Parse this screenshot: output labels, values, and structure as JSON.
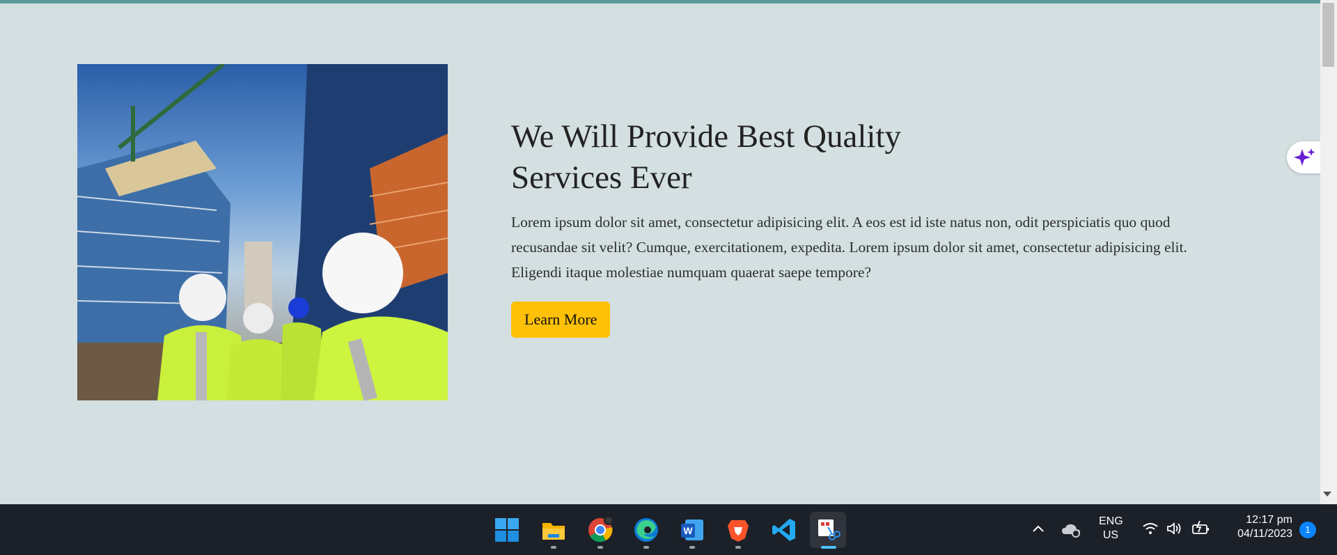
{
  "hero": {
    "title_line1": "We Will Provide Best Quality",
    "title_line2": "Services Ever",
    "description": "Lorem ipsum dolor sit amet, consectetur adipisicing elit. A eos est id iste natus non, odit perspiciatis quo quod recusandae sit velit? Cumque, exercitationem, expedita. Lorem ipsum dolor sit amet, consectetur adipisicing elit. Eligendi itaque molestiae numquam quaerat saepe tempore?",
    "button_label": "Learn More",
    "button_color": "#ffc107",
    "image_icon": "construction-workers-photo"
  },
  "page": {
    "background": "#d3dfe1",
    "accent": "#5b9a9c"
  },
  "floating": {
    "icon": "sparkle-icon",
    "color": "#6a1fd1"
  },
  "taskbar": {
    "apps": [
      {
        "name": "windows-start-icon"
      },
      {
        "name": "file-explorer-icon"
      },
      {
        "name": "chrome-icon"
      },
      {
        "name": "edge-icon"
      },
      {
        "name": "word-icon"
      },
      {
        "name": "brave-icon"
      },
      {
        "name": "vscode-icon"
      },
      {
        "name": "snipping-tool-icon",
        "active": true
      }
    ],
    "tray": {
      "language_line1": "ENG",
      "language_line2": "US",
      "time": "12:17 pm",
      "date": "04/11/2023",
      "notification_count": "1"
    }
  }
}
